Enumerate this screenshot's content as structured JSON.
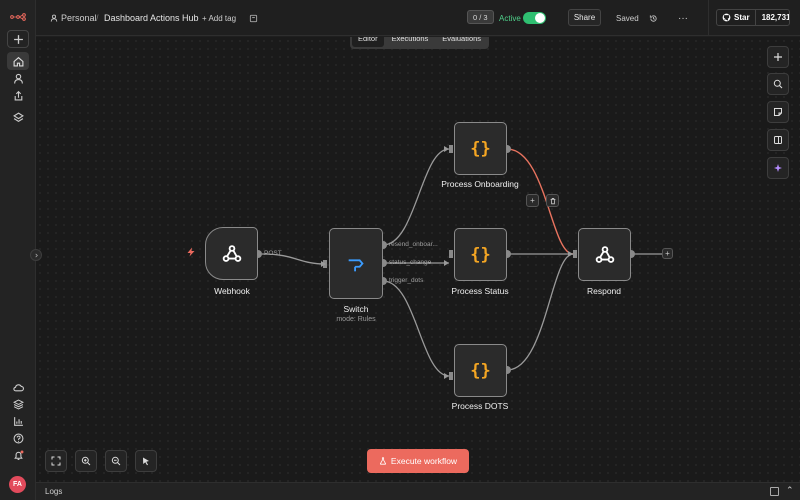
{
  "header": {
    "project_label": "Personal",
    "separator": "/",
    "workflow_title": "Dashboard Actions Hub",
    "add_tag_label": "+ Add tag",
    "node_count": "0 / 3",
    "active_label": "Active",
    "active": true,
    "share_label": "Share",
    "saved_label": "Saved",
    "more_label": "···",
    "github_star_label": "Star",
    "github_star_count": "182,731"
  },
  "view_tabs": [
    {
      "label": "Editor",
      "active": true
    },
    {
      "label": "Executions",
      "active": false
    },
    {
      "label": "Evaluations",
      "active": false
    }
  ],
  "sidebar": {
    "avatar_initials": "FA",
    "top_items": [
      "add-icon",
      "home-icon",
      "user-icon",
      "share-icon",
      "layers-icon"
    ],
    "bottom_items": [
      "cloud-icon",
      "templates-icon",
      "insights-icon",
      "help-icon",
      "bell-icon"
    ]
  },
  "nodes": {
    "webhook": {
      "label": "Webhook",
      "port_label": "POST"
    },
    "switch": {
      "label": "Switch",
      "subtitle": "mode: Rules",
      "outputs": [
        "resend_onboar...",
        "status_change",
        "trigger_dots"
      ]
    },
    "process_onboarding": {
      "label": "Process Onboarding"
    },
    "process_status": {
      "label": "Process Status"
    },
    "process_dots": {
      "label": "Process DOTS"
    },
    "respond": {
      "label": "Respond"
    }
  },
  "execute_button_label": "Execute workflow",
  "logs_label": "Logs",
  "colors": {
    "accent": "#ec6a5e",
    "active_green": "#2fbf71",
    "code_icon": "#f5a623",
    "switch_icon": "#3b9cff",
    "highlight_edge": "#e8735f"
  }
}
